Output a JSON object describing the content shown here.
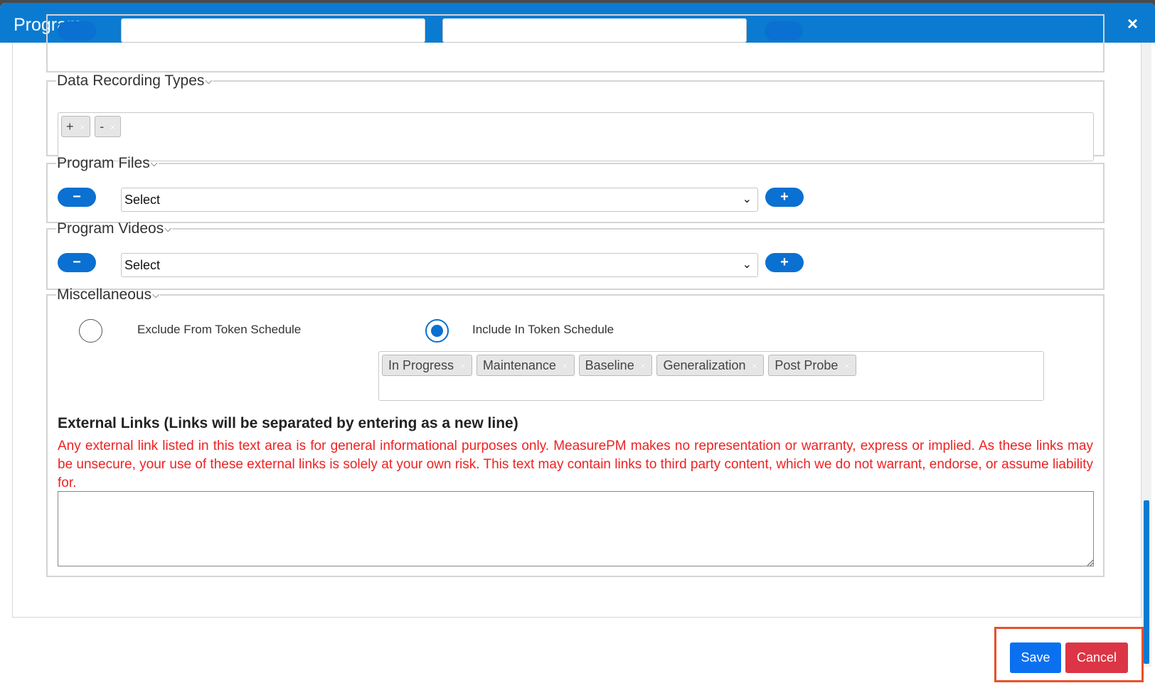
{
  "modal": {
    "title": "Program",
    "close_glyph": "×"
  },
  "sections": {
    "data_recording_types": {
      "legend": "Data Recording Types",
      "tags": [
        {
          "label": "+"
        },
        {
          "label": "-"
        }
      ]
    },
    "program_files": {
      "legend": "Program Files",
      "select_value": "Select",
      "remove_glyph": "−",
      "add_glyph": "+"
    },
    "program_videos": {
      "legend": "Program Videos",
      "select_value": "Select",
      "remove_glyph": "−",
      "add_glyph": "+"
    },
    "miscellaneous": {
      "legend": "Miscellaneous",
      "radio_exclude": "Exclude From Token Schedule",
      "radio_include": "Include In Token Schedule",
      "selected": "Include In Token Schedule",
      "tags": [
        "In Progress",
        "Maintenance",
        "Baseline",
        "Generalization",
        "Post Probe"
      ]
    }
  },
  "external_links": {
    "heading": "External Links (Links will be separated by entering as a new line)",
    "warning": "Any external link listed in this text area is for general informational purposes only. MeasurePM makes no representation or warranty, express or implied. As these links may be unsecure, your use of these external links is solely at your own risk. This text may contain links to third party content, which we do not warrant, endorse, or assume liability for.",
    "value": ""
  },
  "footer": {
    "save_label": "Save",
    "cancel_label": "Cancel"
  },
  "colors": {
    "header": "#0a7bd1",
    "primary": "#0a70f0",
    "danger": "#dc3545",
    "warning_text": "#ee2222",
    "highlight": "#e8502a"
  },
  "icons": {
    "close": "close-icon",
    "chevron": "chevron-down-icon",
    "minus": "minus-icon",
    "plus": "plus-icon"
  }
}
